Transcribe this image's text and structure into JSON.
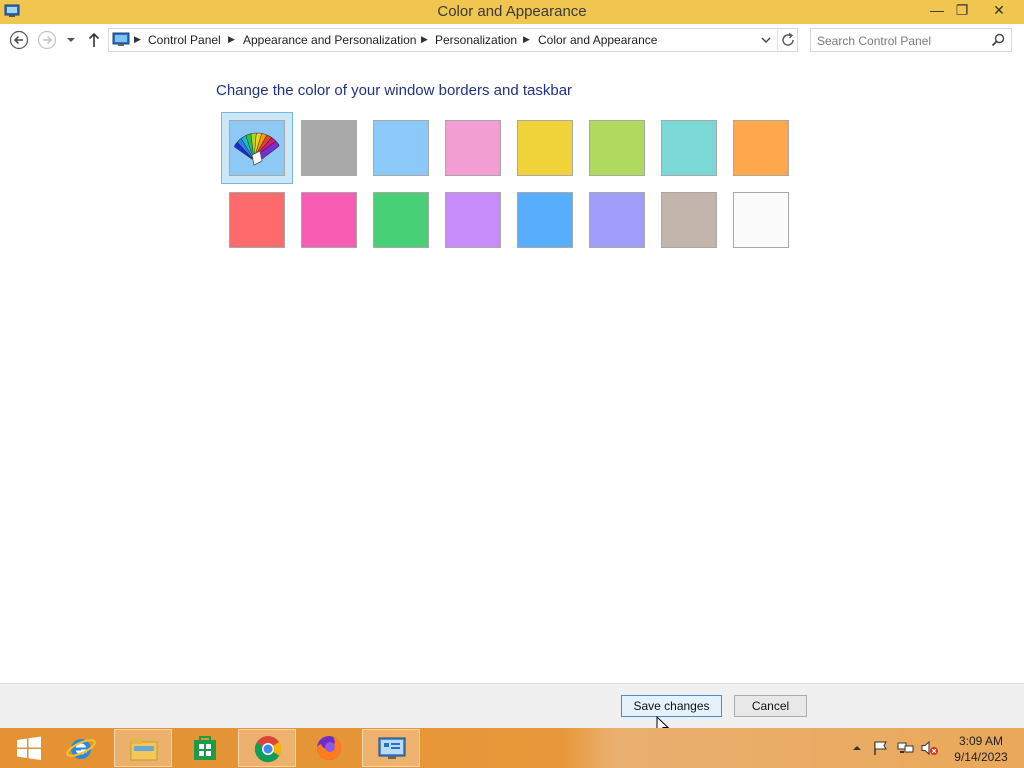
{
  "window": {
    "title": "Color and Appearance",
    "controls": {
      "minimize": "—",
      "maximize": "❐",
      "close": "✕"
    }
  },
  "navigation": {
    "breadcrumbs": [
      "Control Panel",
      "Appearance and Personalization",
      "Personalization",
      "Color and Appearance"
    ],
    "search_placeholder": "Search Control Panel"
  },
  "content": {
    "heading": "Change the color of your window borders and taskbar",
    "colors": [
      {
        "color": "#8ec9f5",
        "type": "automatic",
        "selected": true
      },
      {
        "color": "#a9a9a9"
      },
      {
        "color": "#8cc9fb"
      },
      {
        "color": "#f39ed3"
      },
      {
        "color": "#f0d23a"
      },
      {
        "color": "#afd95f"
      },
      {
        "color": "#7ad8d6"
      },
      {
        "color": "#fea74d"
      },
      {
        "color": "#fe6b6d"
      },
      {
        "color": "#f65db2"
      },
      {
        "color": "#47d076"
      },
      {
        "color": "#c78cf9"
      },
      {
        "color": "#57aefc"
      },
      {
        "color": "#a19efb"
      },
      {
        "color": "#c4b5ac"
      },
      {
        "color": "#fbfbfb"
      }
    ]
  },
  "buttons": {
    "save": "Save changes",
    "cancel": "Cancel"
  },
  "taskbar": {
    "apps": [
      "start",
      "internet-explorer",
      "file-explorer",
      "store",
      "chrome",
      "firefox",
      "control-panel"
    ],
    "active_app": "control-panel",
    "clock": {
      "time": "3:09 AM",
      "date": "9/14/2023"
    }
  }
}
